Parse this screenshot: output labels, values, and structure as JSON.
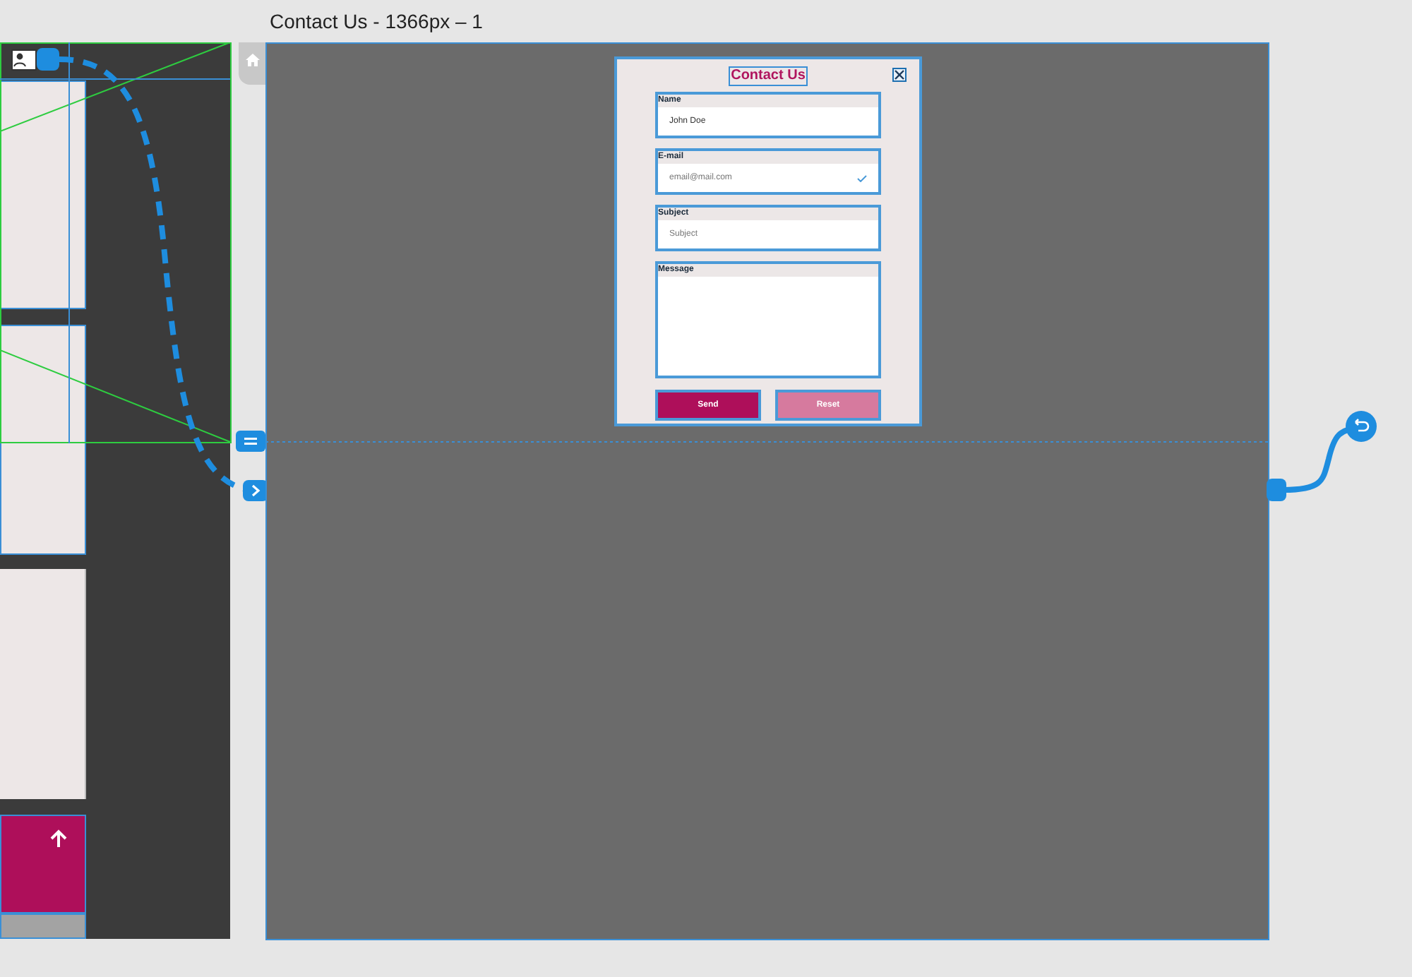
{
  "artboard": {
    "title": "Contact Us - 1366px – 1"
  },
  "form": {
    "title": "Contact Us",
    "fields": [
      {
        "kind": "text",
        "label": "Name",
        "value": "John Doe"
      },
      {
        "kind": "valid",
        "label": "E-mail",
        "placeholder": "email@mail.com"
      },
      {
        "kind": "text",
        "label": "Subject",
        "placeholder": "Subject"
      },
      {
        "kind": "area",
        "label": "Message"
      }
    ],
    "buttons": [
      {
        "label": "Send",
        "kind": "primary"
      },
      {
        "label": "Reset",
        "kind": "secondary"
      }
    ]
  }
}
